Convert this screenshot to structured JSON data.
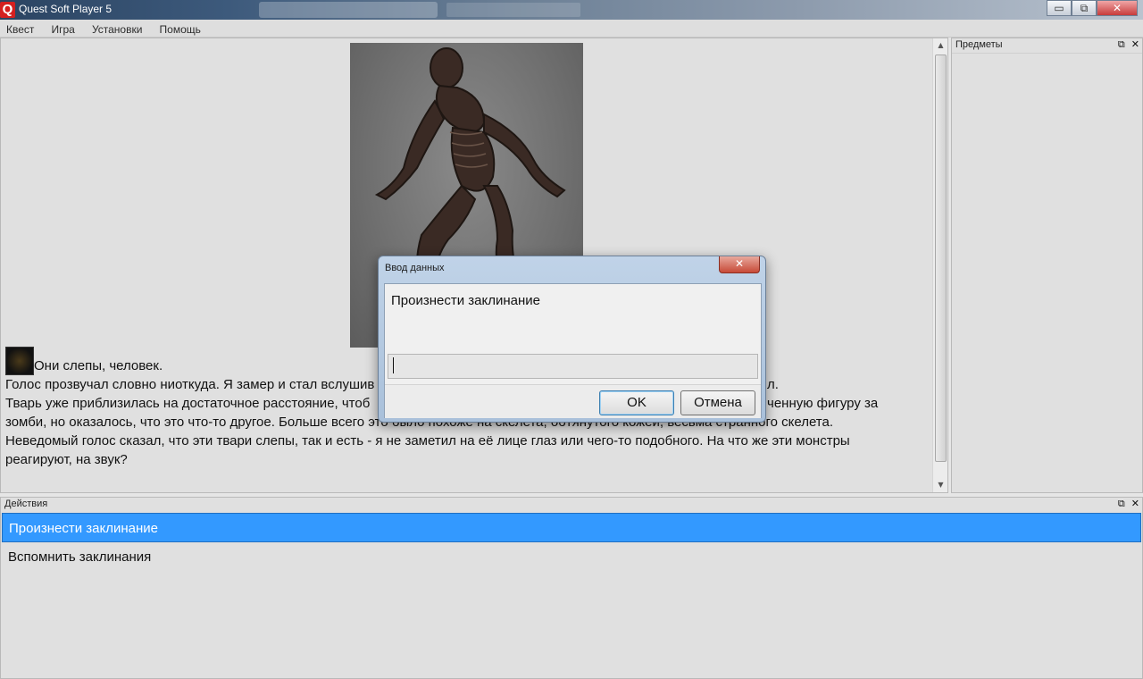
{
  "window": {
    "logo": "Q",
    "title": "Quest Soft Player 5",
    "minimize": "▭",
    "maximize": "⧉",
    "close": "✕"
  },
  "menu": [
    "Квест",
    "Игра",
    "Установки",
    "Помощь"
  ],
  "story": {
    "lines": [
      "Они слепы, человек.",
      "Голос прозвучал словно ниоткуда. Я замер и стал вслушив",
      "Тварь уже приблизилась на достаточное расстояние, чтоб",
      "зомби, но оказалось, что это что-то другое. Больше всего это было похоже на скелета, обтянутого кожей, весьма странного скелета.",
      "Неведомый голос сказал, что эти твари слепы, так и есть - я не заметил на её лице глаз или чего-то подобного. На что же эти монстры",
      "реагируют, на звук?"
    ],
    "line2_tail": "л.",
    "line3_tail": "ченную фигуру за"
  },
  "items_panel": {
    "title": "Предметы",
    "restore": "⧉",
    "close": "✕"
  },
  "actions_panel": {
    "title": "Действия",
    "restore": "⧉",
    "close": "✕",
    "items": [
      "Произнести заклинание",
      "Вспомнить заклинания"
    ]
  },
  "dialog": {
    "title": "Ввод данных",
    "close": "✕",
    "prompt": "Произнести заклинание",
    "input_value": "",
    "ok": "OK",
    "cancel": "Отмена"
  }
}
